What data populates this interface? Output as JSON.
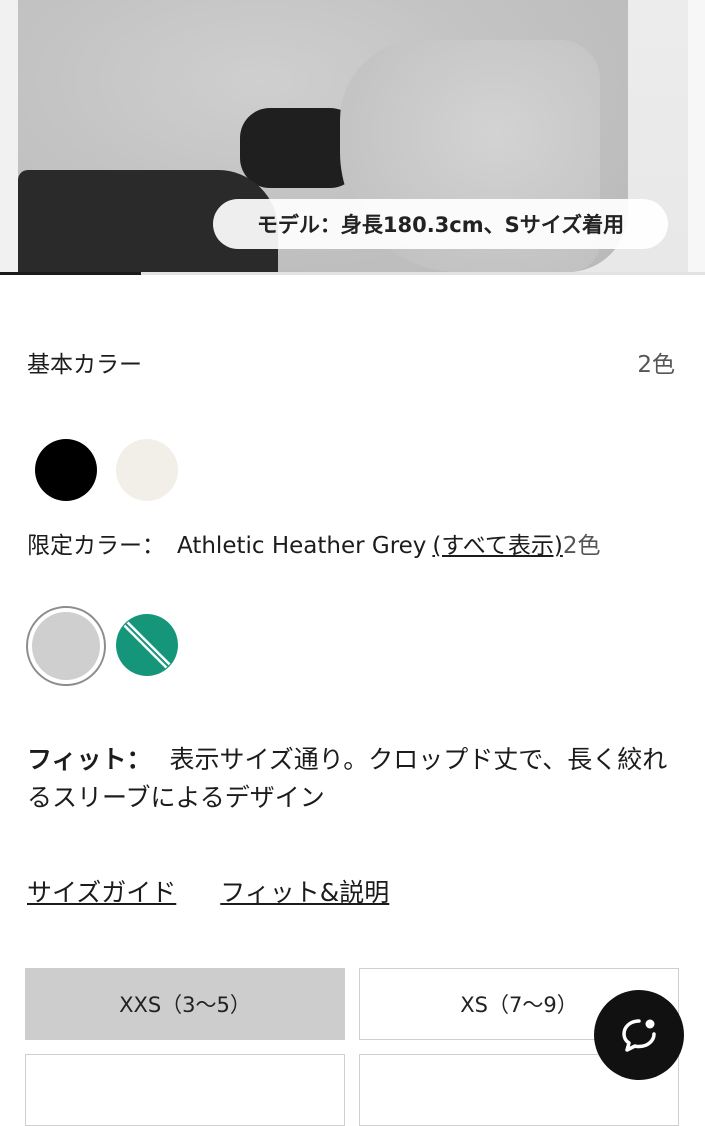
{
  "hero": {
    "model_caption": "モデル：身長180.3cm、Sサイズ着用",
    "carousel_progress": 0.2
  },
  "basic_colors": {
    "label": "基本カラー",
    "count": "2色",
    "swatches": [
      {
        "name": "Black",
        "color": "#000000"
      },
      {
        "name": "White",
        "color": "#f2efe9"
      }
    ]
  },
  "limited_colors": {
    "label": "限定カラー：",
    "selected": "Athletic Heather Grey",
    "show_all": "(すべて表示)",
    "count": "2色",
    "swatches": [
      {
        "name": "Athletic Heather Grey",
        "color": "#cfcfcf",
        "selected": true
      },
      {
        "name": "Teal",
        "color": "#15967a",
        "selected": false
      }
    ]
  },
  "fit": {
    "label": "フィット：",
    "description": "表示サイズ通り。クロップド丈で、長く絞れるスリーブによるデザイン"
  },
  "links": {
    "size_guide": "サイズガイド",
    "fit_details": "フィット&説明"
  },
  "sizes": [
    {
      "label": "XXS（3〜5）",
      "selected": true
    },
    {
      "label": "XS（7〜9）",
      "selected": false
    }
  ],
  "chat": {
    "icon": "chat-bubble-icon"
  }
}
